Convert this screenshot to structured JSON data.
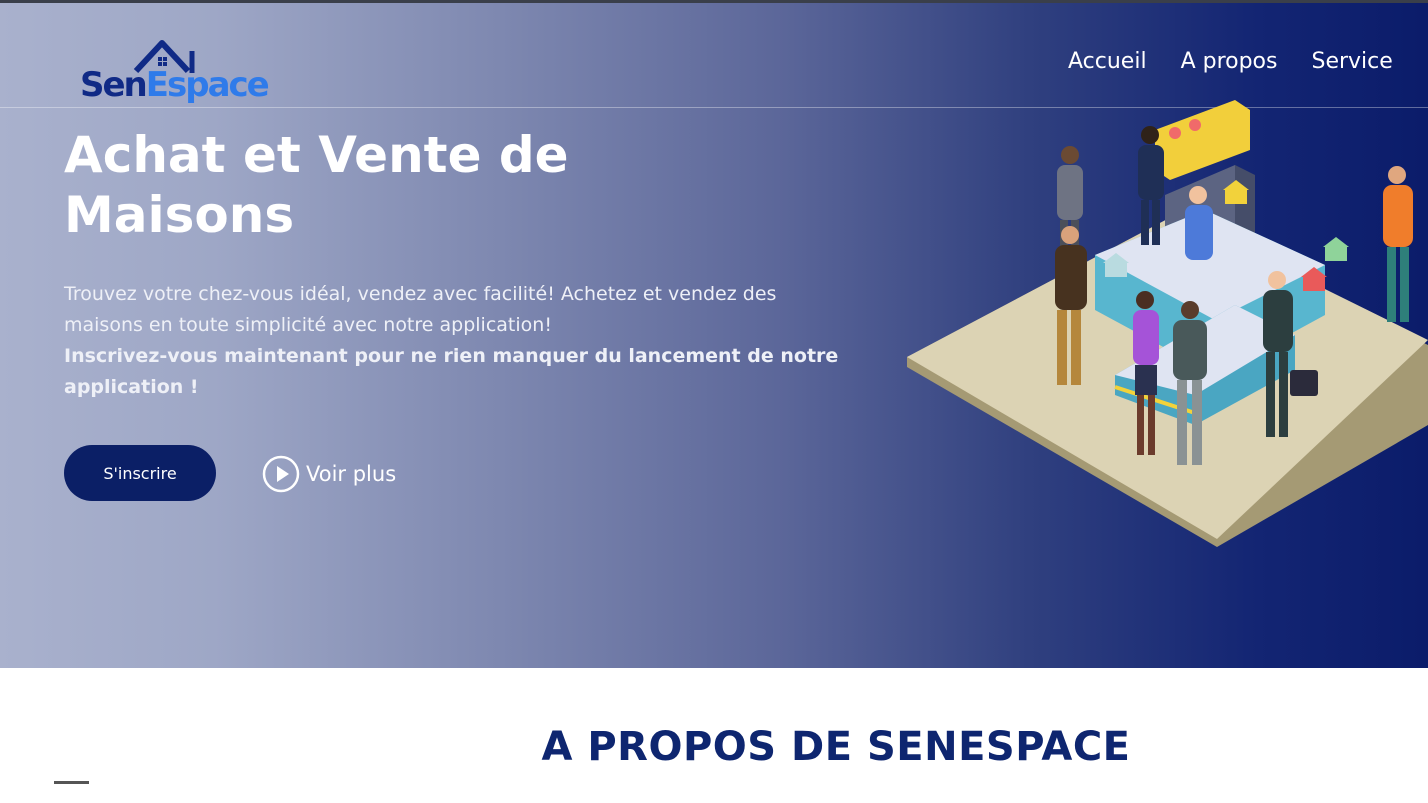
{
  "brand": {
    "part1": "Sen",
    "part2": "Espace"
  },
  "nav": {
    "items": [
      "Accueil",
      "A propos",
      "Service"
    ]
  },
  "hero": {
    "title": "Achat et Vente de Maisons",
    "text": "Trouvez votre chez-vous idéal, vendez avec facilité! Achetez et vendez des maisons en toute simplicité avec notre application!",
    "bold_text": "Inscrivez-vous maintenant pour ne rien manquer du lancement de notre application !",
    "signup_label": "S'inscrire",
    "more_label": "Voir plus"
  },
  "about": {
    "title": "A PROPOS DE SENESPACE"
  },
  "colors": {
    "brand_dark": "#102a86",
    "brand_light": "#2f7bea",
    "button": "#0b1f66"
  }
}
